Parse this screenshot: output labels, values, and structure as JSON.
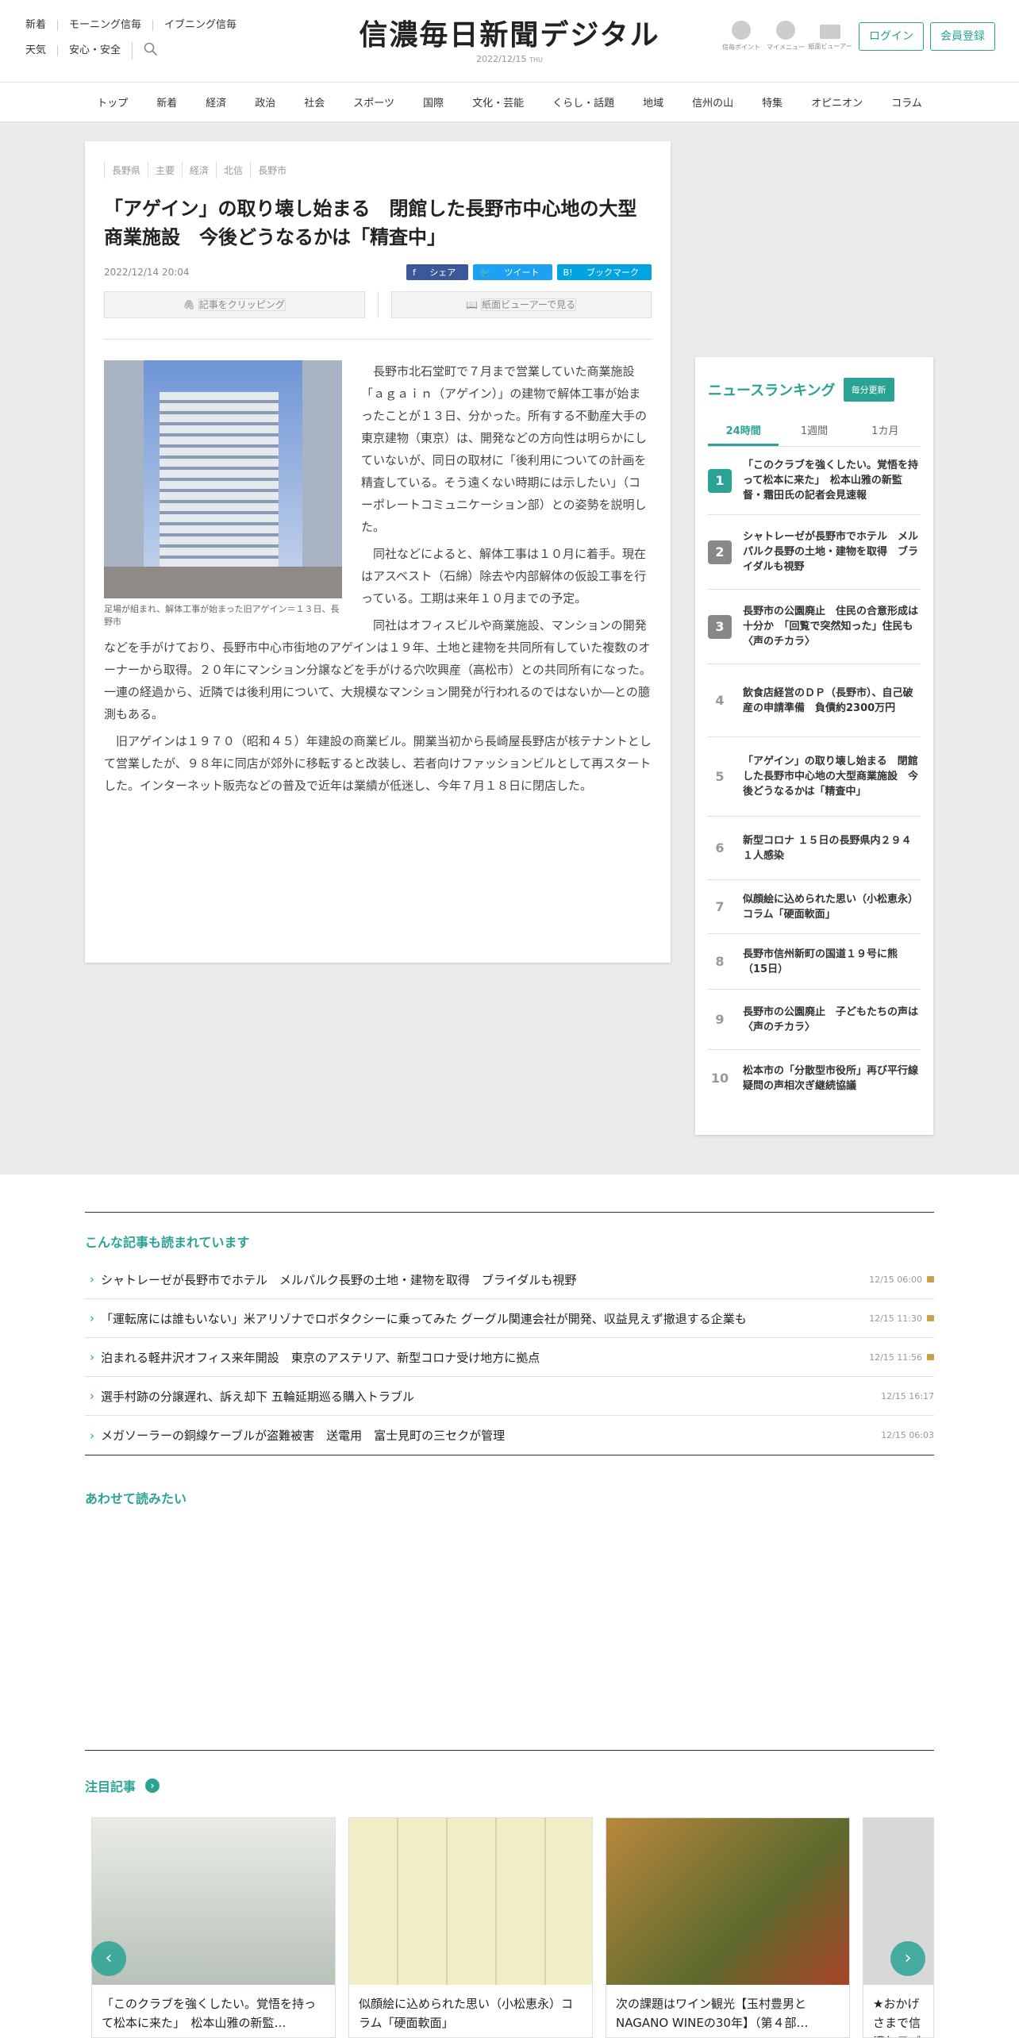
{
  "header": {
    "links_row1": [
      "新着",
      "モーニング信毎",
      "イブニング信毎"
    ],
    "links_row2": [
      "天気",
      "安心・安全"
    ],
    "logo": "信濃毎日新聞デジタル",
    "date": "2022/12/15",
    "weekday": "THU",
    "icons": [
      {
        "label": "信毎ポイント",
        "icon": "point-icon"
      },
      {
        "label": "マイメニュー",
        "icon": "person-icon"
      },
      {
        "label": "紙面ビューアー",
        "icon": "book-icon"
      }
    ],
    "login": "ログイン",
    "register": "会員登録"
  },
  "nav": [
    "トップ",
    "新着",
    "経済",
    "政治",
    "社会",
    "スポーツ",
    "国際",
    "文化・芸能",
    "くらし・話題",
    "地域",
    "信州の山",
    "特集",
    "オピニオン",
    "コラム"
  ],
  "article": {
    "tags": [
      "長野県",
      "主要",
      "経済",
      "北信",
      "長野市"
    ],
    "title": "「アゲイン」の取り壊し始まる　閉館した長野市中心地の大型商業施設　今後どうなるかは「精査中」",
    "datetime": "2022/12/14 20:04",
    "share": [
      "シェア",
      "ツイート",
      "ブックマーク"
    ],
    "clip": "記事をクリッピング",
    "viewer": "紙面ビューアーで見る",
    "caption": "足場が組まれ、解体工事が始まった旧アゲイン＝１３日、長野市",
    "paragraphs": [
      "長野市北石堂町で７月まで営業していた商業施設「ａｇａｉｎ（アゲイン）」の建物で解体工事が始まったことが１３日、分かった。所有する不動産大手の東京建物（東京）は、開発などの方向性は明らかにしていないが、同日の取材に「後利用についての計画を精査している。そう遠くない時期には示したい」（コーポレートコミュニケーション部）との姿勢を説明した。",
      "同社などによると、解体工事は１０月に着手。現在はアスベスト（石綿）除去や内部解体の仮設工事を行っている。工期は来年１０月までの予定。",
      "同社はオフィスビルや商業施設、マンションの開発などを手がけており、長野市中心市街地のアゲインは１９年、土地と建物を共同所有していた複数のオーナーから取得。２０年にマンション分譲などを手がける穴吹興産（高松市）との共同所有になった。一連の経過から、近隣では後利用について、大規模なマンション開発が行われるのではないか―との臆測もある。",
      "旧アゲインは１９７０（昭和４５）年建設の商業ビル。開業当初から長崎屋長野店が核テナントとして営業したが、９８年に同店が郊外に移転すると改装し、若者向けファッションビルとして再スタートした。インターネット販売などの普及で近年は業績が低迷し、今年７月１８日に閉店した。"
    ]
  },
  "ranking": {
    "title": "ニュースランキング",
    "badge": "毎分更新",
    "tabs": [
      "24時間",
      "1週間",
      "1カ月"
    ],
    "items": [
      "「このクラブを強くしたい。覚悟を持って松本に来た」　松本山雅の新監督・霜田氏の記者会見速報",
      "シャトレーゼが長野市でホテル　メルパルク長野の土地・建物を取得　ブライダルも視野",
      "長野市の公園廃止　住民の合意形成は十分か　「回覧で突然知った」住民も〈声のチカラ〉",
      "飲食店経営のＤＰ（長野市）、自己破産の申請準備　負債約2300万円",
      "「アゲイン」の取り壊し始まる　閉館した長野市中心地の大型商業施設　今後どうなるかは「精査中」",
      "新型コロナ １５日の長野県内２９４１人感染",
      "似顔絵に込められた思い（小松恵永）コラム「硬面軟面」",
      "長野市信州新町の国道１９号に熊（15日）",
      "長野市の公園廃止　子どもたちの声は〈声のチカラ〉",
      "松本市の「分散型市役所」再び平行線　疑問の声相次ぎ継続協議"
    ]
  },
  "also_read": {
    "title": "こんな記事も読まれています",
    "items": [
      {
        "text": "シャトレーゼが長野市でホテル　メルパルク長野の土地・建物を取得　ブライダルも視野",
        "time": "12/15 06:00",
        "locked": true
      },
      {
        "text": "「運転席には誰もいない」米アリゾナでロボタクシーに乗ってみた グーグル関連会社が開発、収益見えず撤退する企業も",
        "time": "12/15 11:30",
        "locked": true
      },
      {
        "text": "泊まれる軽井沢オフィス来年開設　東京のアステリア、新型コロナ受け地方に拠点",
        "time": "12/15 11:56",
        "locked": true
      },
      {
        "text": "選手村跡の分譲遅れ、訴え却下 五輪延期巡る購入トラブル",
        "time": "12/15 16:17",
        "locked": false
      },
      {
        "text": "メガソーラーの銅線ケーブルが盗難被害　送電用　富士見町の三セクが管理",
        "time": "12/15 06:03",
        "locked": false
      }
    ]
  },
  "together": {
    "title": "あわせて読みたい"
  },
  "featured": {
    "title": "注目記事",
    "cards": [
      {
        "text": "「このクラブを強くしたい。覚悟を持って松本に来た」　松本山雅の新監…",
        "color": "#cfd6cf"
      },
      {
        "text": "似顔絵に込められた思い（小松恵永）コラム「硬面軟面」",
        "color": "#e8e4b0"
      },
      {
        "text": "次の課題はワイン観光【玉村豊男とNAGANO WINEの30年】（第４部…",
        "color": "#a86a3a"
      },
      {
        "text": "★おかげさまで信濃毎日デジタル…",
        "color": "#dcdcdc"
      }
    ]
  },
  "colors": {
    "accent": "#2aa394"
  }
}
